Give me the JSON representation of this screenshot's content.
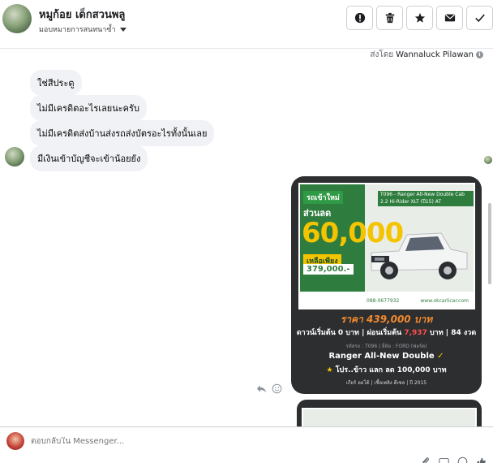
{
  "header": {
    "contact_name": "หมูก้อย เด็กสวนพลู",
    "assign_label": "มอบหมายการสนทนาซ้ำ",
    "toolbar": [
      "report-icon",
      "trash-icon",
      "star-icon",
      "mail-icon",
      "check-icon"
    ]
  },
  "sent_by": {
    "prefix": "ส่งโดย",
    "name": "Wannaluck Pilawan"
  },
  "messages": [
    {
      "text": "ใช่สีประตู"
    },
    {
      "text": "ไม่มีเครดิตอะไรเลยนะครับ"
    },
    {
      "text": "ไม่มีเครดิตส่งบ้านส่งรถส่งบัตรอะไรทั้งนั้นเลย"
    },
    {
      "text": "มีเงินเข้าบัญชีจะเข้าน้อยยัง"
    }
  ],
  "card": {
    "poster": {
      "top_label": "รถเข้าใหม่",
      "sale_label": "ส่วนลด",
      "discount": "60,000",
      "remain_label": "เหลือเพียง",
      "remain_price": "379,000.-",
      "model_line": "T096 - Ranger All-New Double Cab 2.2 Hi-Rider XLT (ปี15) AT",
      "phone": "088-0677932",
      "web": "www.okcarlicar.com"
    },
    "price_text": "ราคา 439,000 บาท",
    "terms_prefix": "ดาวน์เริ่มต้น 0 บาท | ผ่อนเริ่มต้น",
    "terms_amount": "7,937",
    "terms_suffix": "บาท | 84 งวด",
    "meta": "รหัสรถ : T096 | ยี่ห้อ : FORD (ฟอร์ด)",
    "model": "Ranger All-New Double",
    "promo_prefix": "โปร..ข้าว แลก ลด 100,000 บาท",
    "specs": "เกียร์ ออโต้  |  เชื้อเพลิง ดีเซล  |  ปี 2015"
  },
  "reply": {
    "placeholder": "ตอบกลับใน Messenger..."
  },
  "colors": {
    "accent_orange": "#f28a2e",
    "brand_green": "#2f7d3e",
    "brand_yellow": "#f5c400",
    "card_bg": "#2d2e30"
  }
}
